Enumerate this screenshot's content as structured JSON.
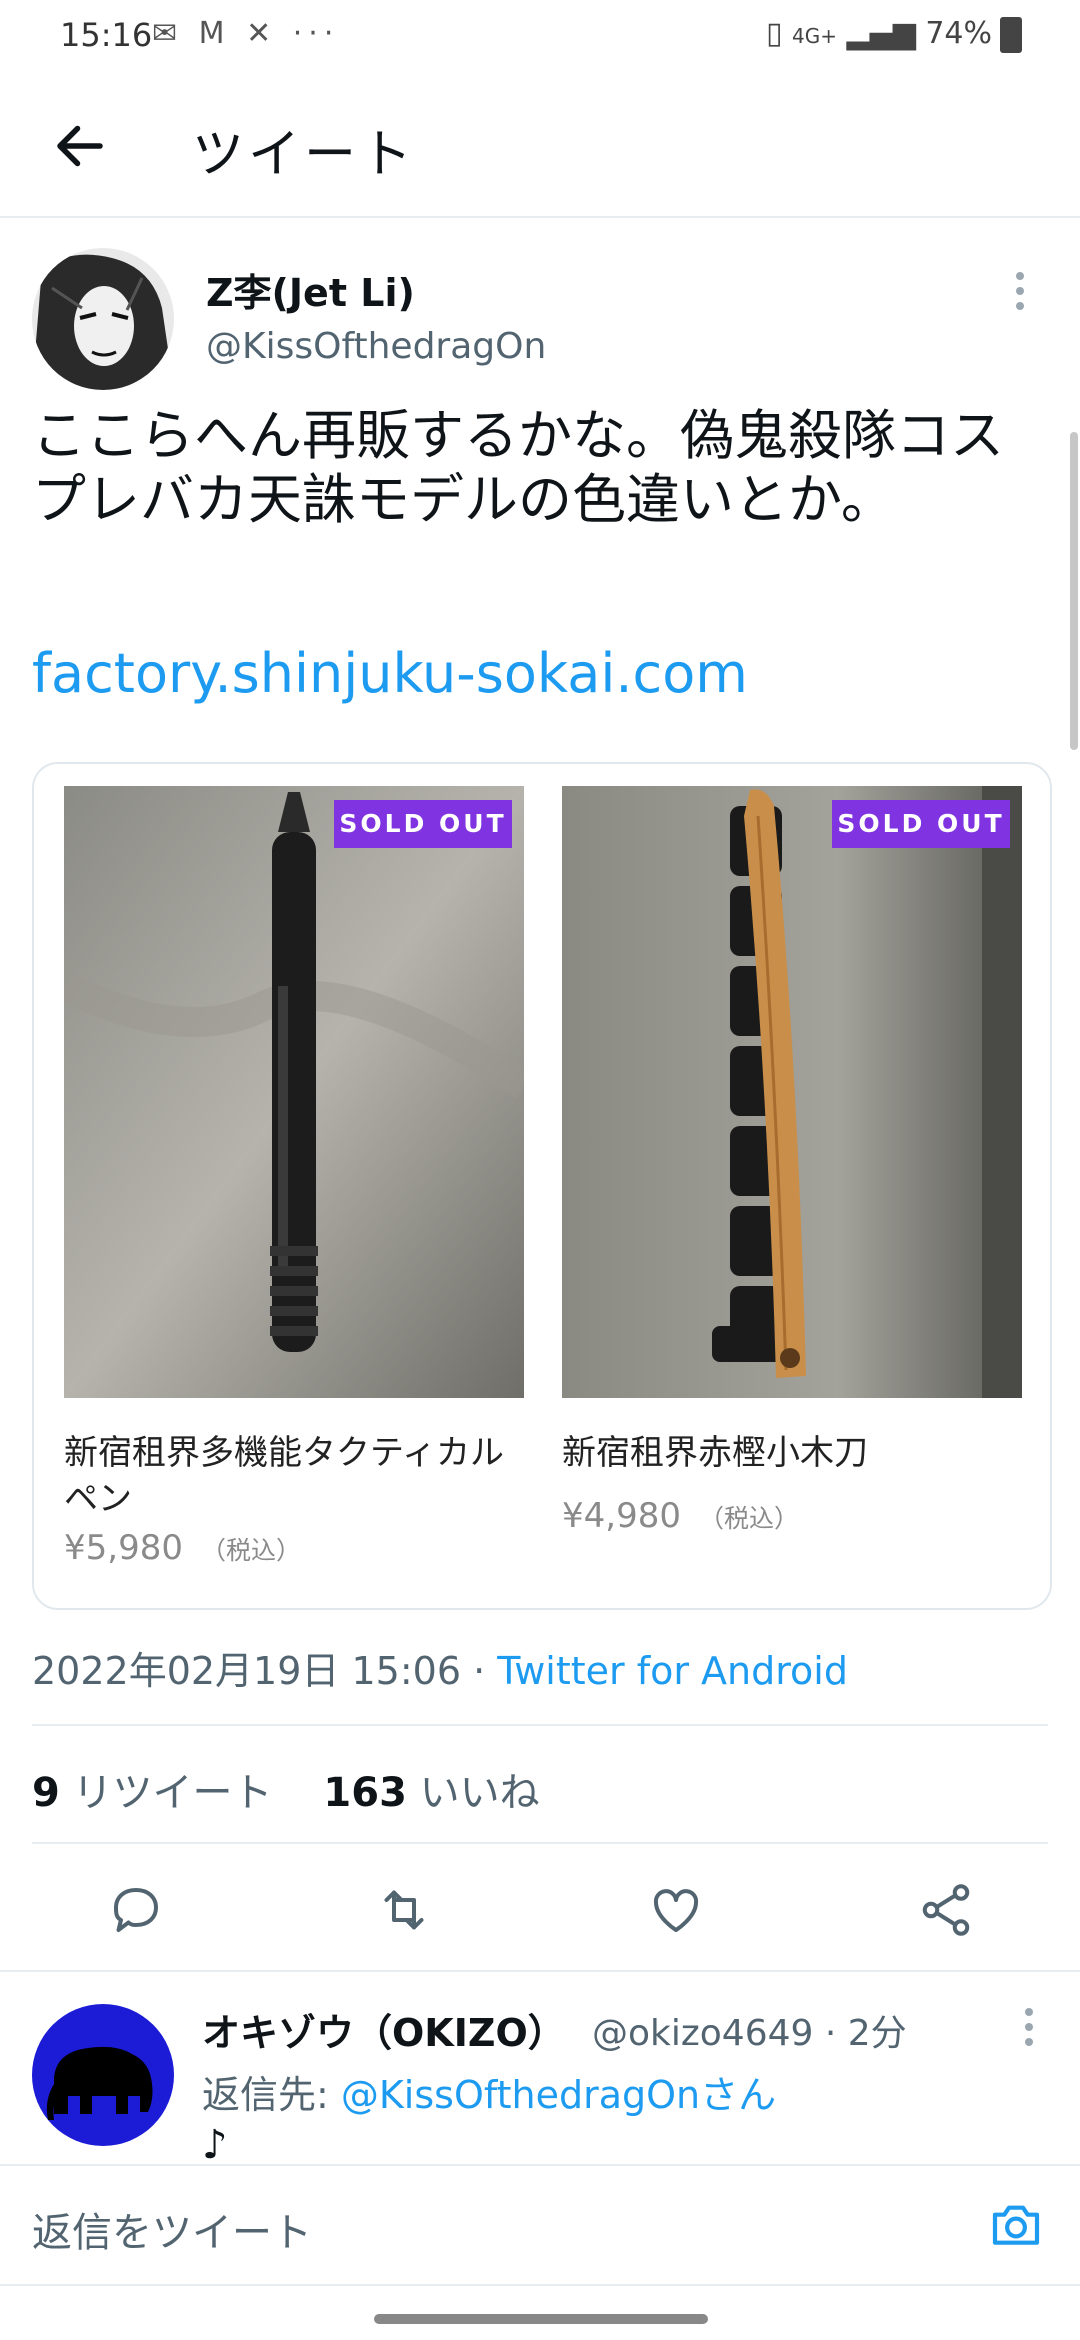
{
  "status_bar": {
    "time": "15:16",
    "left_icons": "✉ M ✕ ···",
    "signal": "4G+",
    "battery": "74%"
  },
  "header": {
    "title": "ツイート"
  },
  "tweet": {
    "author_name": "Z李(Jet Li)",
    "author_handle": "@KissOfthedragOn",
    "text": "ここらへん再販するかな。偽鬼殺隊コスプレバカ天誅モデルの色違いとか。",
    "link": "factory.shinjuku-sokai.com",
    "products": [
      {
        "name": "新宿租界多機能タクティカルペン",
        "price": "¥5,980",
        "tax": "（税込）",
        "badge": "SOLD OUT"
      },
      {
        "name": "新宿租界赤樫小木刀",
        "price": "¥4,980",
        "tax": "（税込）",
        "badge": "SOLD OUT"
      }
    ],
    "timestamp": "2022年02月19日 15:06",
    "separator": " · ",
    "source": "Twitter for Android",
    "retweet_count": "9",
    "retweet_label": "リツイート",
    "like_count": "163",
    "like_label": "いいね"
  },
  "actions": [
    "reply-icon",
    "retweet-icon",
    "like-icon",
    "share-icon"
  ],
  "reply": {
    "name": "オキゾウ（OKIZO）",
    "handle_time": "@okizo4649 · 2分",
    "reply_to_prefix": "返信先: ",
    "reply_to_mention": "@KissOfthedragOnさん",
    "text": "♪"
  },
  "compose": {
    "placeholder": "返信をツイート"
  },
  "colors": {
    "link": "#1d9bf0",
    "badge": "#8033e0",
    "muted": "#536471"
  }
}
